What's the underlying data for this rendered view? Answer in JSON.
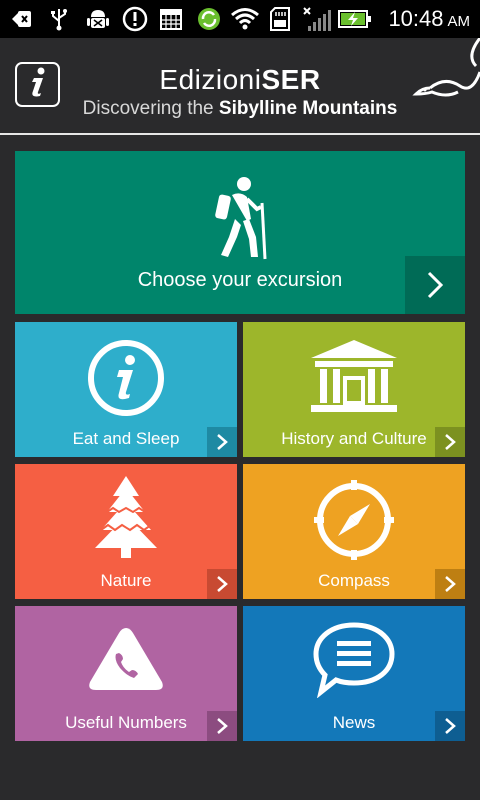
{
  "status_bar": {
    "time": "10:48",
    "ampm": "AM",
    "icons": [
      "back-icon",
      "usb-icon",
      "android-debug-icon",
      "alert-icon",
      "calendar-icon",
      "sync-icon",
      "wifi-icon",
      "sd-card-icon",
      "signal-icon",
      "battery-charging-icon"
    ]
  },
  "header": {
    "brand_light": "Edizioni",
    "brand_bold": "SER",
    "subtitle_light": "Discovering the ",
    "subtitle_bold": "Sibylline Mountains",
    "info_icon": "info-icon"
  },
  "tiles": {
    "excursion": {
      "label": "Choose your excursion",
      "icon": "hiker-icon",
      "color": "#00856b"
    },
    "eat_sleep": {
      "label": "Eat and Sleep",
      "icon": "info-circle-icon",
      "color": "#2eaecb"
    },
    "history": {
      "label": "History and Culture",
      "icon": "temple-icon",
      "color": "#9db62b"
    },
    "nature": {
      "label": "Nature",
      "icon": "tree-icon",
      "color": "#f55f43"
    },
    "compass": {
      "label": "Compass",
      "icon": "compass-icon",
      "color": "#eea222"
    },
    "useful": {
      "label": "Useful Numbers",
      "icon": "phone-triangle-icon",
      "color": "#b064a2"
    },
    "news": {
      "label": "News",
      "icon": "speech-bubble-icon",
      "color": "#1378b9"
    }
  }
}
